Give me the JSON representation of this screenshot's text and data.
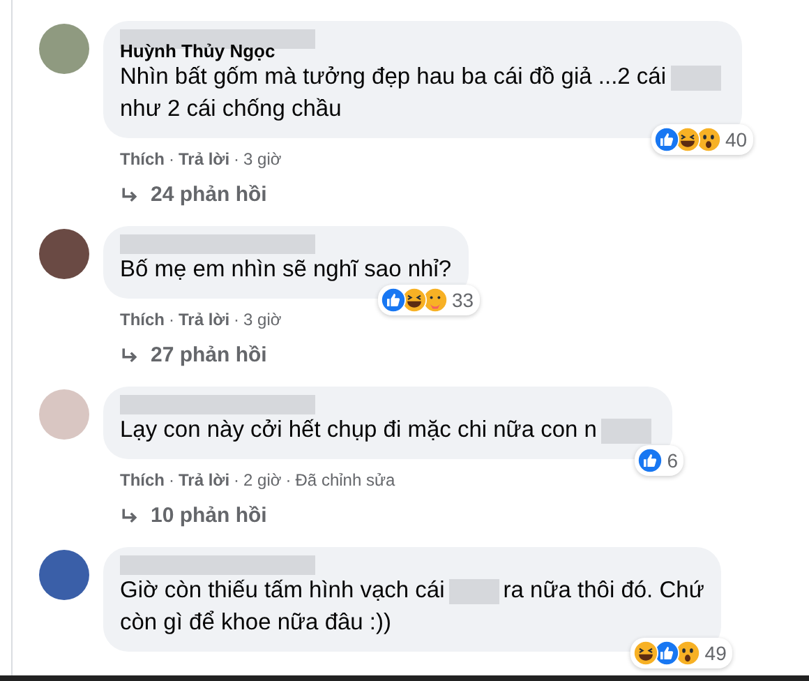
{
  "separator": "·",
  "comments": [
    {
      "author": "Huỳnh Thủy Ngọc",
      "author_blurred": true,
      "segments": [
        {
          "kind": "text",
          "text": "Nhìn bất gốm mà tưởng đẹp hau ba cái đồ giả ...2 cái"
        },
        {
          "kind": "blur"
        },
        {
          "kind": "break"
        },
        {
          "kind": "text",
          "text": "như 2 cái chống chầu"
        }
      ],
      "reactions": [
        {
          "kind": "like"
        },
        {
          "kind": "haha"
        },
        {
          "kind": "wow"
        }
      ],
      "reaction_count": "40",
      "actions": [
        "Thích",
        "Trả lời",
        "3 giờ"
      ],
      "replies": "24 phản hồi"
    },
    {
      "author_blurred": true,
      "segments": [
        {
          "kind": "text",
          "text": "Bố mẹ em nhìn sẽ nghĩ sao nhỉ?"
        }
      ],
      "reactions": [
        {
          "kind": "like"
        },
        {
          "kind": "haha"
        },
        {
          "kind": "care"
        }
      ],
      "reaction_count": "33",
      "actions": [
        "Thích",
        "Trả lời",
        "3 giờ"
      ],
      "replies": "27 phản hồi"
    },
    {
      "author_blurred": true,
      "segments": [
        {
          "kind": "text",
          "text": "Lạy con này cởi hết chụp đi mặc chi nữa con n"
        },
        {
          "kind": "blur"
        }
      ],
      "reactions": [
        {
          "kind": "like"
        }
      ],
      "reaction_count": "6",
      "actions": [
        "Thích",
        "Trả lời",
        "2 giờ",
        "Đã chỉnh sửa"
      ],
      "replies": "10 phản hồi"
    },
    {
      "author_blurred": true,
      "segments": [
        {
          "kind": "text",
          "text": "Giờ còn thiếu tấm hình vạch cái"
        },
        {
          "kind": "blur"
        },
        {
          "kind": "text",
          "text": "ra nữa thôi đó. Chứ"
        },
        {
          "kind": "break"
        },
        {
          "kind": "text",
          "text": "còn gì để khoe nữa đâu :))"
        }
      ],
      "reactions": [
        {
          "kind": "haha"
        },
        {
          "kind": "like"
        },
        {
          "kind": "wow"
        }
      ],
      "reaction_count": "49"
    }
  ]
}
